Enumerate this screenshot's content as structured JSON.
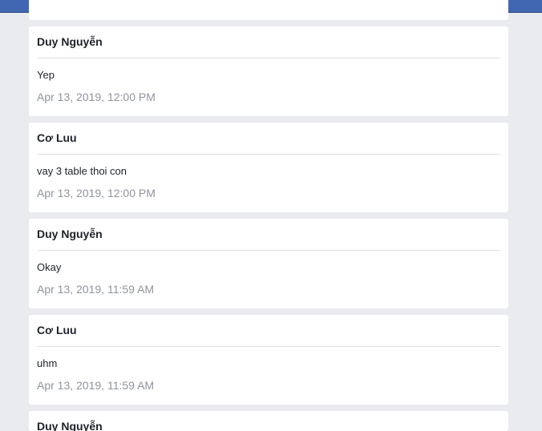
{
  "header": {
    "logo_icon": "facebook-logo-icon",
    "avatar_icon": "user-avatar-icon",
    "brand_color": "#4267b2"
  },
  "messages": [
    {
      "author": "Duy Nguyễn",
      "text": "Yep",
      "time": "Apr 13, 2019, 12:00 PM"
    },
    {
      "author": "Cơ Luu",
      "text": "vay 3 table thoi con",
      "time": "Apr 13, 2019, 12:00 PM"
    },
    {
      "author": "Duy Nguyễn",
      "text": "Okay",
      "time": "Apr 13, 2019, 11:59 AM"
    },
    {
      "author": "Cơ Luu",
      "text": "uhm",
      "time": "Apr 13, 2019, 11:59 AM"
    },
    {
      "author": "Duy Nguyễn",
      "text": "",
      "time": ""
    }
  ]
}
